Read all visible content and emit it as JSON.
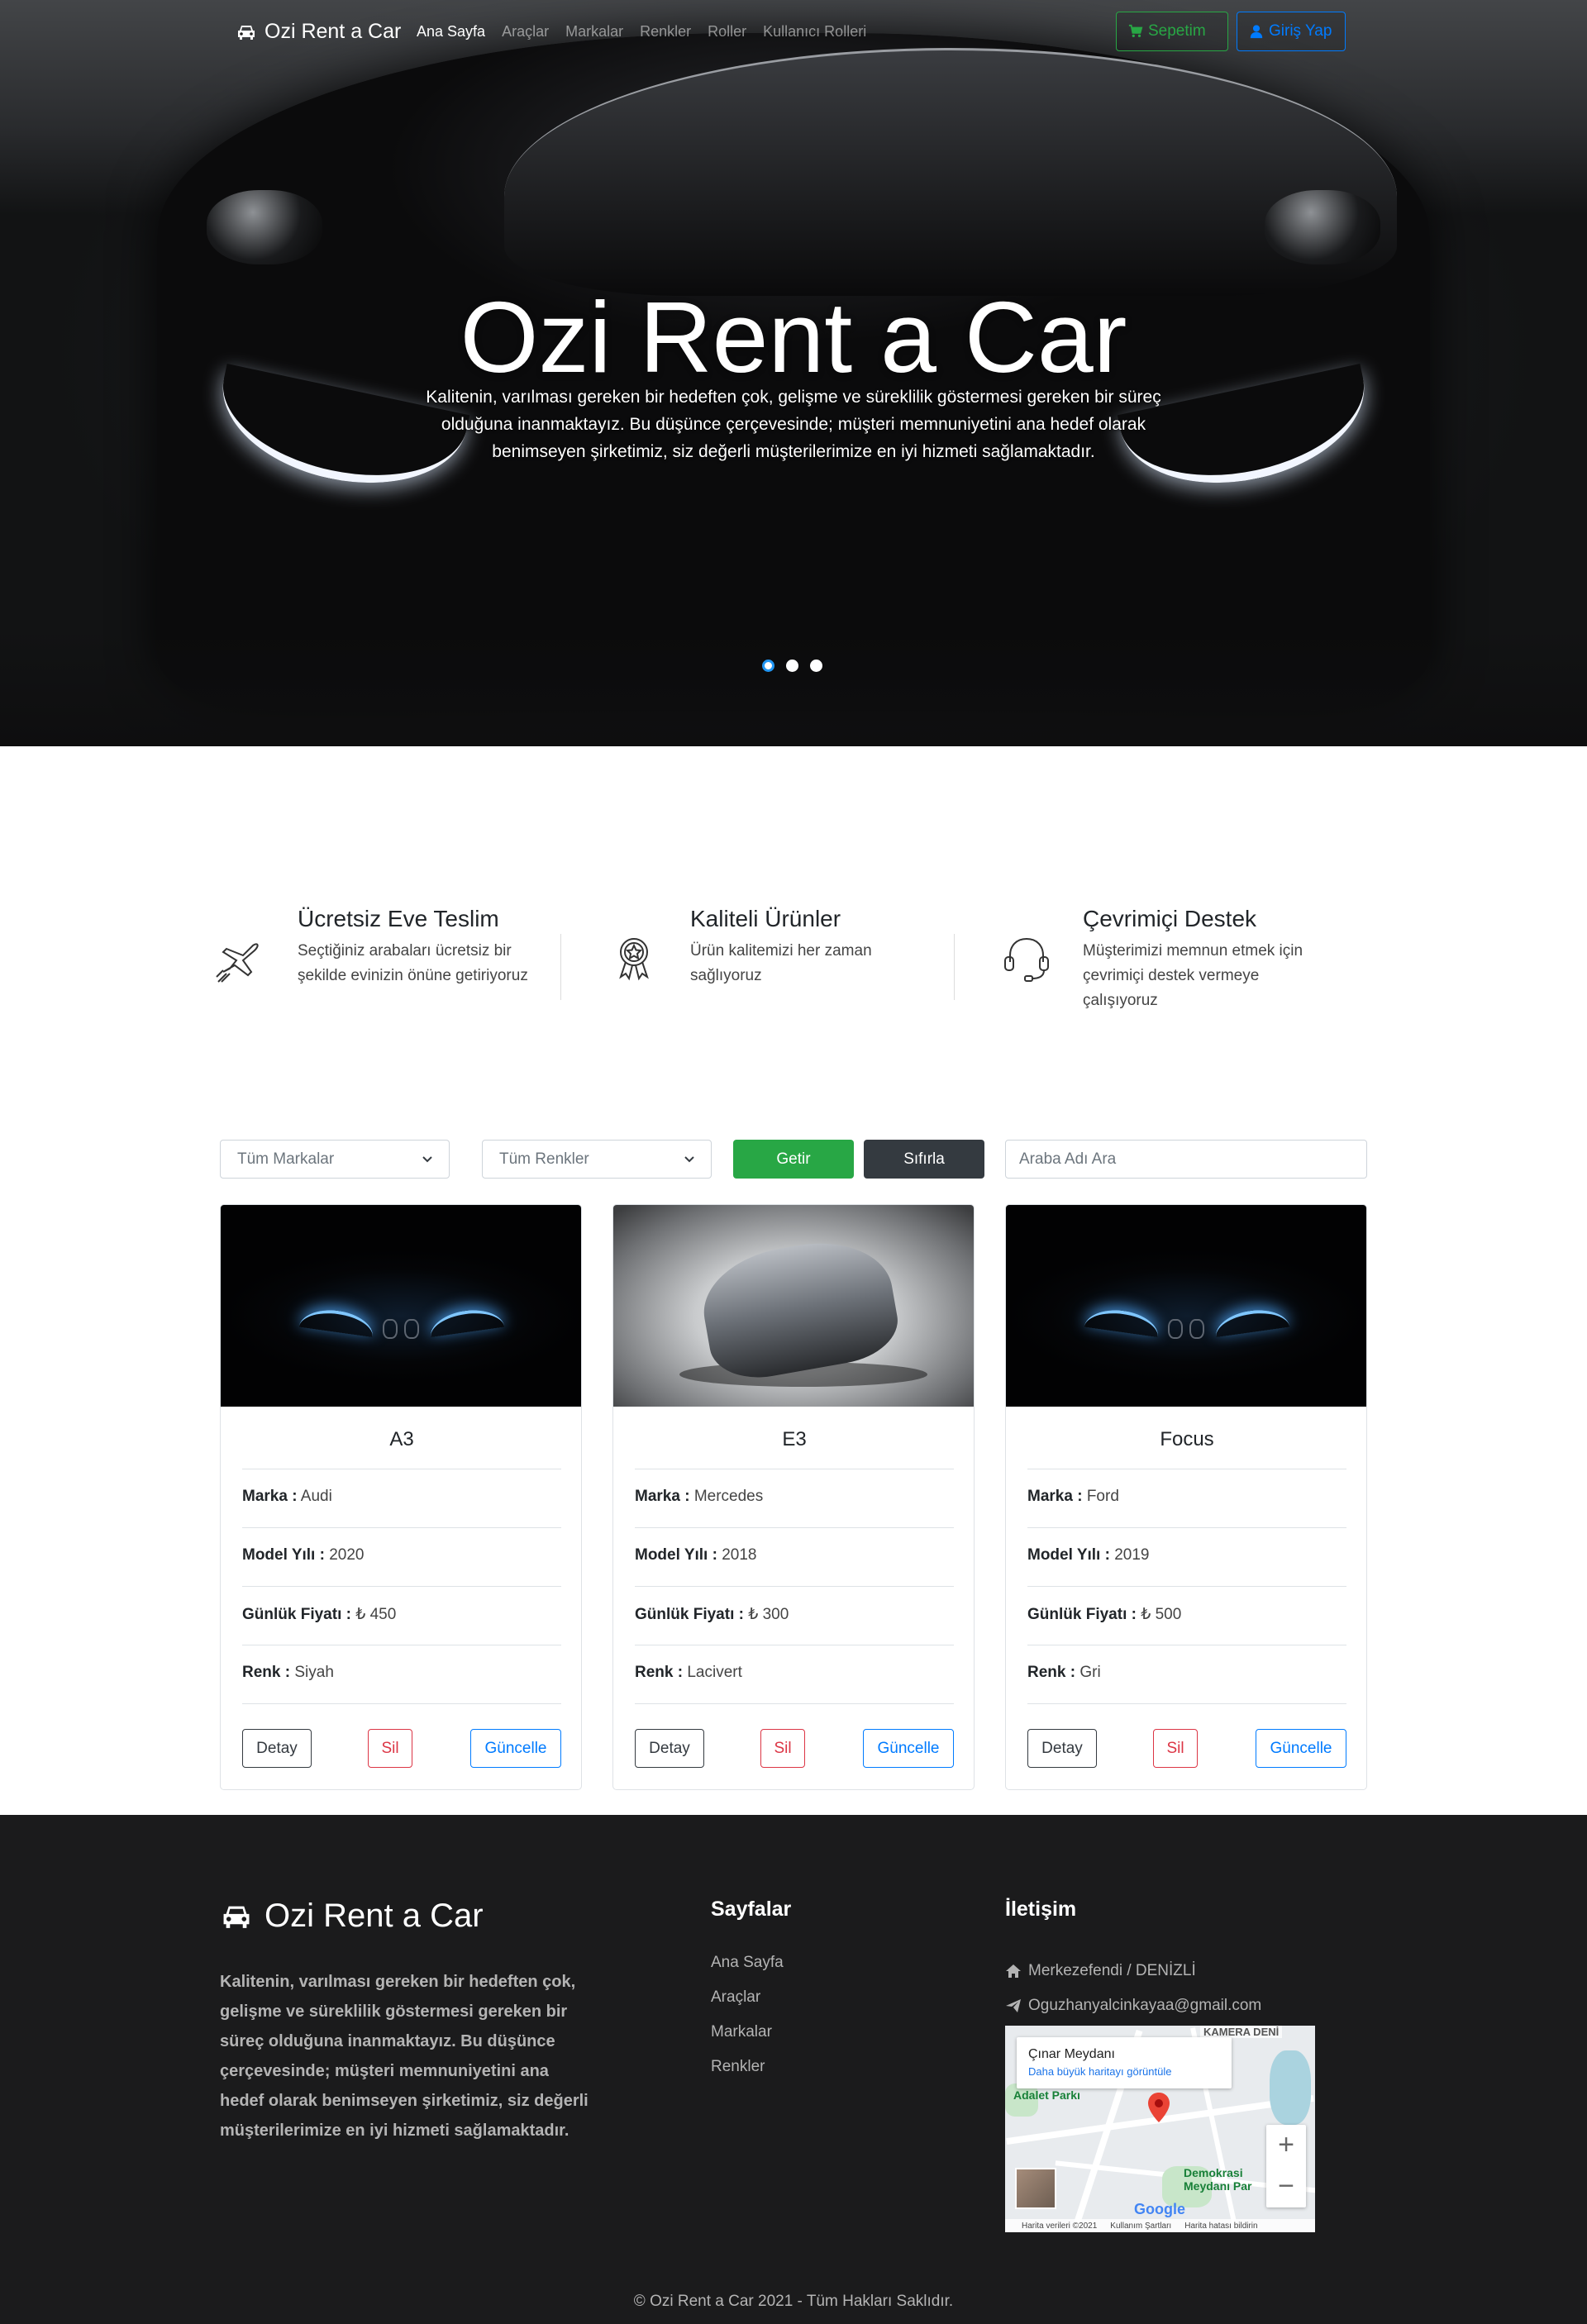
{
  "navbar": {
    "brand": "Ozi Rent a Car",
    "links": [
      "Ana Sayfa",
      "Araçlar",
      "Markalar",
      "Renkler",
      "Roller",
      "Kullanıcı Rolleri"
    ],
    "active_link": "Ana Sayfa",
    "cart_label": "Sepetim",
    "login_label": "Giriş Yap",
    "colors": {
      "cart": "#28a745",
      "login": "#007bff"
    }
  },
  "hero": {
    "title": "Ozi Rent a Car",
    "text": "Kalitenin, varılması gereken bir hedeften çok, gelişme ve süreklilik göstermesi gereken bir süreç olduğuna inanmaktayız. Bu düşünce çerçevesinde; müşteri memnuniyetini ana hedef olarak benimseyen şirketimiz, siz değerli müşterilerimize en iyi hizmeti sağlamaktadır.",
    "slides": 3,
    "active_slide": 1
  },
  "features": [
    {
      "icon": "airplane-icon",
      "title": "Ücretsiz Eve Teslim",
      "desc": "Seçtiğiniz arabaları ücretsiz bir şekilde evinizin önüne getiriyoruz"
    },
    {
      "icon": "award-icon",
      "title": "Kaliteli Ürünler",
      "desc": "Ürün kalitemizi her zaman sağlıyoruz"
    },
    {
      "icon": "headset-icon",
      "title": "Çevrimiçi Destek",
      "desc": "Müşterimizi memnun etmek için çevrimiçi destek vermeye çalışıyoruz"
    }
  ],
  "filters": {
    "brand_select": "Tüm Markalar",
    "color_select": "Tüm Renkler",
    "apply_label": "Getir",
    "reset_label": "Sıfırla",
    "search_placeholder": "Araba Adı Ara"
  },
  "card_labels": {
    "brand": "Marka :",
    "model_year": "Model Yılı :",
    "daily_price": "Günlük Fiyatı :",
    "color": "Renk :",
    "detail": "Detay",
    "delete": "Sil",
    "update": "Güncelle"
  },
  "cars": [
    {
      "name": "A3",
      "brand": "Audi",
      "model_year": "2020",
      "daily_price": "₺ 450",
      "color": "Siyah"
    },
    {
      "name": "E3",
      "brand": "Mercedes",
      "model_year": "2018",
      "daily_price": "₺ 300",
      "color": "Lacivert"
    },
    {
      "name": "Focus",
      "brand": "Ford",
      "model_year": "2019",
      "daily_price": "₺ 500",
      "color": "Gri"
    }
  ],
  "footer": {
    "brand": "Ozi Rent a Car",
    "about": "Kalitenin, varılması gereken bir hedeften çok, gelişme ve süreklilik göstermesi gereken bir süreç olduğuna inanmaktayız. Bu düşünce çerçevesinde; müşteri memnuniyetini ana hedef olarak benimseyen şirketimiz, siz değerli müşterilerimize en iyi hizmeti sağlamaktadır.",
    "pages_title": "Sayfalar",
    "pages": [
      "Ana Sayfa",
      "Araçlar",
      "Markalar",
      "Renkler"
    ],
    "contact_title": "İletişim",
    "address": "Merkezefendi / DENİZLİ",
    "email": "Oguzhanyalcinkayaa@gmail.com",
    "map": {
      "place": "Çınar Meydanı",
      "larger_map": "Daha büyük haritayı görüntüle",
      "label_park": "Adalet Parkı",
      "label_square": "Demokrasi Meydanı Par",
      "label_kamera": "KAMERA DENİ",
      "google": "Google",
      "foot_data": "Harita verileri ©2021",
      "foot_terms": "Kullanım Şartları",
      "foot_report": "Harita hatası bildirin",
      "zoom_in": "+",
      "zoom_out": "−"
    },
    "copyright": "© Ozi Rent a Car 2021 - Tüm Hakları Saklıdır."
  }
}
